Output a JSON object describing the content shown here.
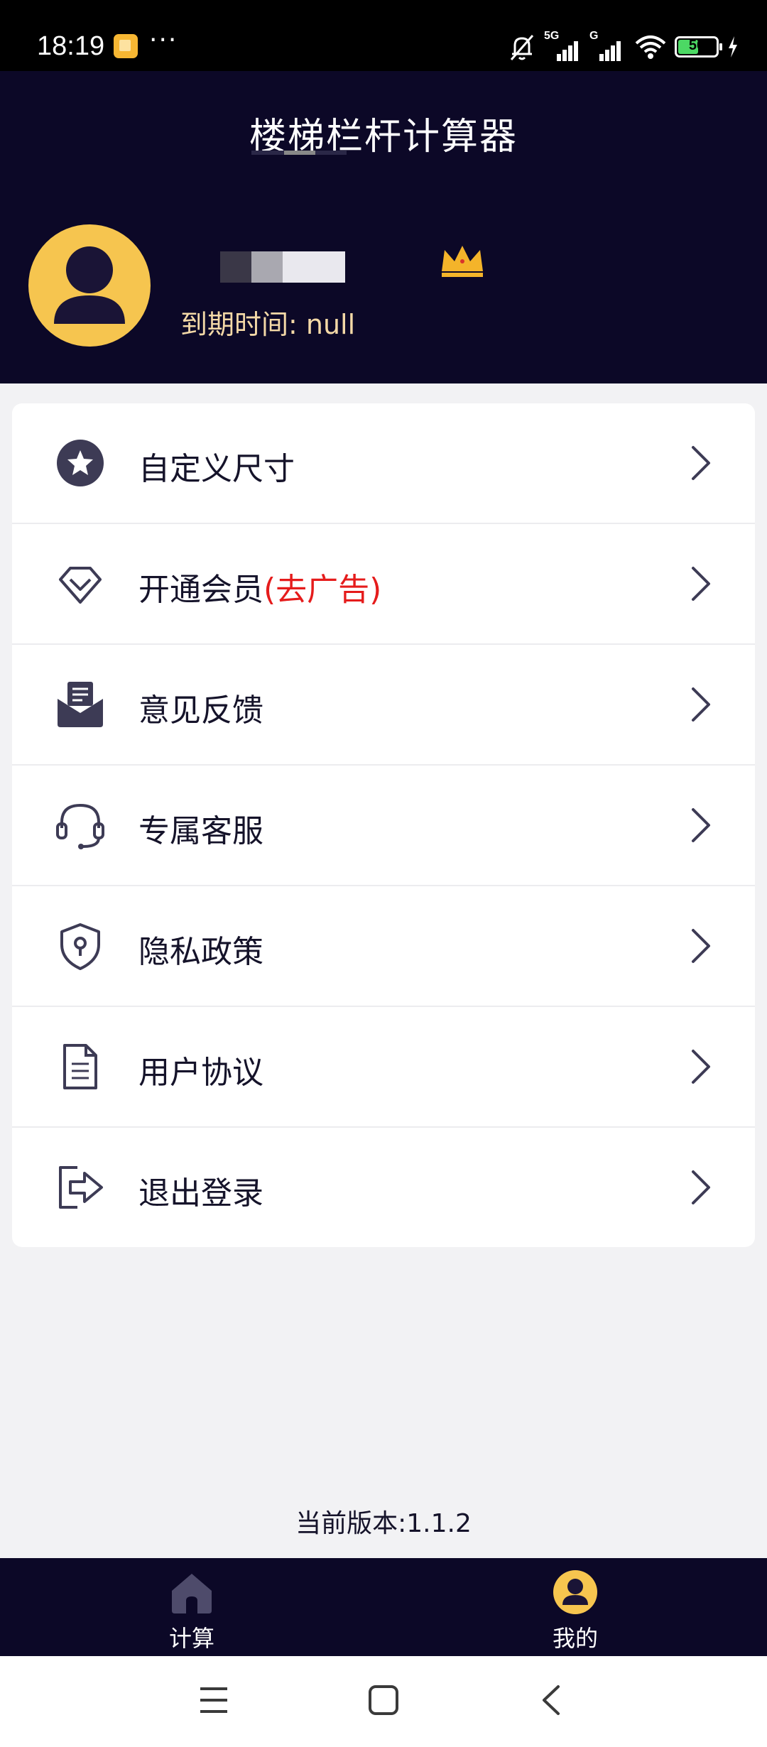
{
  "status_bar": {
    "time": "18:19",
    "overflow": "···",
    "signal_1_label": "5G",
    "signal_2_label": "G",
    "battery": "50"
  },
  "header": {
    "title": "楼梯栏杆计算器",
    "expire_text": "到期时间: null"
  },
  "menu": [
    {
      "label": "自定义尺寸",
      "icon": "star-badge-icon"
    },
    {
      "label": "开通会员",
      "suffix": "(去广告)",
      "icon": "diamond-icon"
    },
    {
      "label": "意见反馈",
      "icon": "mail-feedback-icon"
    },
    {
      "label": "专属客服",
      "icon": "headset-icon"
    },
    {
      "label": "隐私政策",
      "icon": "shield-keyhole-icon"
    },
    {
      "label": "用户协议",
      "icon": "document-icon"
    },
    {
      "label": "退出登录",
      "icon": "logout-icon"
    }
  ],
  "version": "当前版本:1.1.2",
  "tabs": [
    {
      "label": "计算",
      "icon": "home-icon"
    },
    {
      "label": "我的",
      "icon": "user-icon"
    }
  ],
  "colors": {
    "header_bg": "#0c0827",
    "avatar": "#f6c54f",
    "accent_red": "#e51c1c",
    "expire_text": "#f4d9a7",
    "icon": "#3d3b55"
  }
}
